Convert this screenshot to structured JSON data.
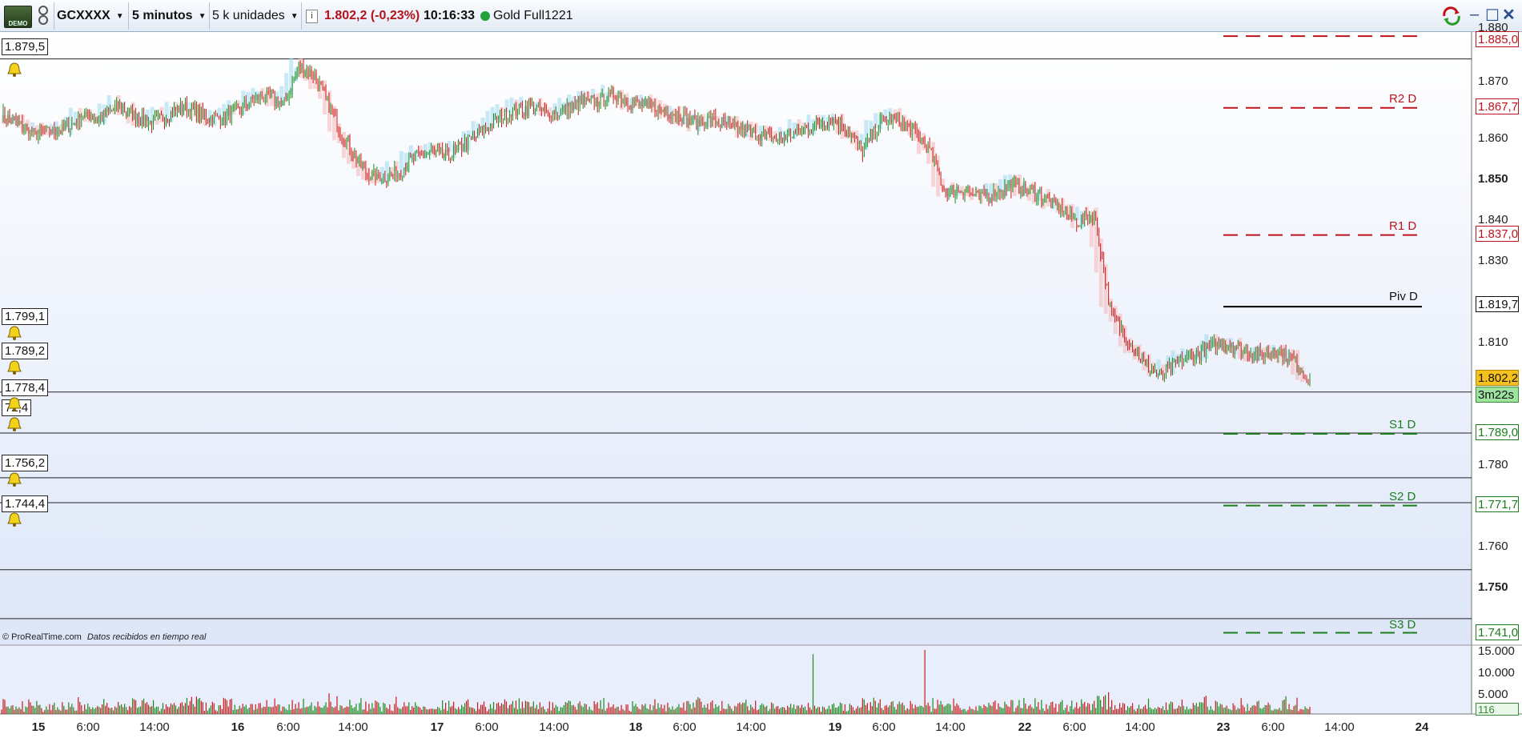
{
  "toolbar": {
    "demo_badge": "DEMO",
    "symbol": "GCXXXX",
    "timeframe": "5 minutos",
    "units": "5 k unidades",
    "info_icon": "i",
    "price": "1.802,2 (-0,23%)",
    "time": "10:16:33",
    "instrument": "Gold Full1221"
  },
  "colors": {
    "resistance": "#c0121b",
    "support": "#1b7d1b",
    "pivot": "#000000",
    "candle_up": "#1a8a1a",
    "candle_down": "#c81a1a",
    "cloud_green": "#9fd8ef",
    "cloud_red": "#f6b6b6",
    "current_price_bg": "#f5c21b",
    "countdown_bg": "#9ee39e"
  },
  "alerts": [
    {
      "value": "1.879,5"
    },
    {
      "value": "1.799,1"
    },
    {
      "value": "1.789,2"
    },
    {
      "value": "1.778,4"
    },
    {
      "value": "72,4"
    },
    {
      "value": "1.756,2"
    },
    {
      "value": "1.744,4"
    }
  ],
  "y_axis": [
    "1.880",
    "1.870",
    "1.860",
    "1.850",
    "1.840",
    "1.830",
    "1.810",
    "1.780",
    "1.760",
    "1.750"
  ],
  "pivots": [
    {
      "label": "R2 D",
      "value": "1.867,7"
    },
    {
      "label": "R1 D",
      "value": "1.837,0"
    },
    {
      "label": "Piv D",
      "value": "1.819,7"
    },
    {
      "label": "S1 D",
      "value": "1.789,0"
    },
    {
      "label": "S2 D",
      "value": "1.771,7"
    },
    {
      "label": "S3 D",
      "value": "1.741,0"
    }
  ],
  "top_tag": "1.885,0",
  "current_price": "1.802,2",
  "countdown": "3m22s",
  "attribution": "© ProRealTime.com",
  "attribution_note": "Datos recibidos en tiempo real",
  "volume_axis": [
    "15.000",
    "10.000",
    "5.000"
  ],
  "volume_current": "116",
  "x_axis": [
    {
      "label": "15",
      "bold": true
    },
    {
      "label": "6:00"
    },
    {
      "label": "14:00"
    },
    {
      "label": "16",
      "bold": true
    },
    {
      "label": "6:00"
    },
    {
      "label": "14:00"
    },
    {
      "label": "17",
      "bold": true
    },
    {
      "label": "6:00"
    },
    {
      "label": "14:00"
    },
    {
      "label": "18",
      "bold": true
    },
    {
      "label": "6:00"
    },
    {
      "label": "14:00"
    },
    {
      "label": "19",
      "bold": true
    },
    {
      "label": "6:00"
    },
    {
      "label": "14:00"
    },
    {
      "label": "22",
      "bold": true
    },
    {
      "label": "6:00"
    },
    {
      "label": "14:00"
    },
    {
      "label": "23",
      "bold": true
    },
    {
      "label": "6:00"
    },
    {
      "label": "14:00"
    },
    {
      "label": "24",
      "bold": true
    }
  ],
  "chart_data": {
    "type": "line",
    "title": "",
    "xlabel": "",
    "ylabel": "",
    "ylim": [
      1738,
      1886
    ],
    "series": [
      {
        "values": [
          1866,
          1864,
          1861,
          1862,
          1863,
          1866,
          1865,
          1868,
          1866,
          1864,
          1866,
          1868,
          1866,
          1865,
          1866,
          1869,
          1871,
          1868,
          1878,
          1875,
          1866,
          1858,
          1852,
          1851,
          1852,
          1856,
          1857,
          1856,
          1859,
          1862,
          1865,
          1867,
          1868,
          1866,
          1867,
          1869,
          1869,
          1871,
          1869,
          1868,
          1867,
          1866,
          1864,
          1865,
          1863,
          1862,
          1861,
          1860,
          1862,
          1863,
          1865,
          1863,
          1857,
          1864,
          1865,
          1862,
          1858,
          1847,
          1848,
          1846,
          1847,
          1849,
          1848,
          1846,
          1843,
          1840,
          1842,
          1818,
          1812,
          1806,
          1803,
          1806,
          1808,
          1810,
          1811,
          1809,
          1808,
          1809,
          1807,
          1802
        ]
      }
    ],
    "volume_max_shown": 15000
  }
}
